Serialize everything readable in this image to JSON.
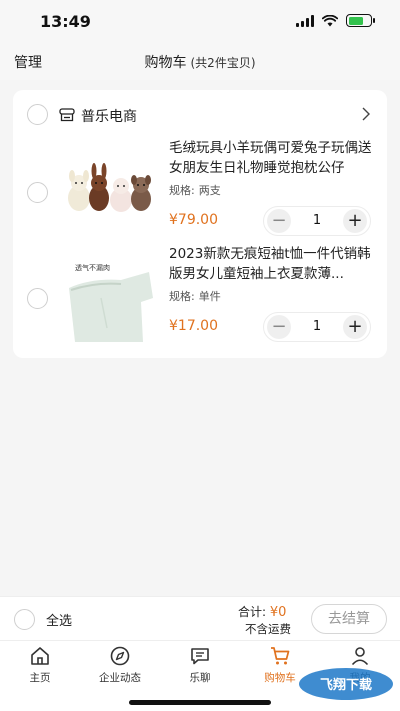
{
  "status_bar": {
    "time": "13:49"
  },
  "nav": {
    "manage": "管理",
    "title": "购物车",
    "subtitle": "(共2件宝贝)"
  },
  "shop": {
    "name": "普乐电商"
  },
  "items": [
    {
      "title": "毛绒玩具小羊玩偶可爱兔子玩偶送女朋友生日礼物睡觉抱枕公仔",
      "spec_label": "规格:",
      "spec_value": "两支",
      "price": "¥79.00",
      "quantity": "1"
    },
    {
      "title": "2023新款无痕短袖t恤一件代销韩版男女儿童短袖上衣夏款薄...",
      "spec_label": "规格:",
      "spec_value": "单件",
      "price": "¥17.00",
      "quantity": "1",
      "thumb_text": "透气不漏肉"
    }
  ],
  "checkout": {
    "select_all": "全选",
    "total_label": "合计:",
    "total_value": "¥0",
    "shipping": "不含运费",
    "button": "去结算"
  },
  "tabs": [
    {
      "label": "主页",
      "icon": "home-icon"
    },
    {
      "label": "企业动态",
      "icon": "compass-icon"
    },
    {
      "label": "乐聊",
      "icon": "chat-icon"
    },
    {
      "label": "购物车",
      "icon": "cart-icon",
      "active": true
    },
    {
      "label": "我的",
      "icon": "user-icon"
    }
  ],
  "watermark": "飞翔下载",
  "colors": {
    "accent": "#e0721f",
    "background": "#f5f5f5",
    "card": "#ffffff"
  }
}
